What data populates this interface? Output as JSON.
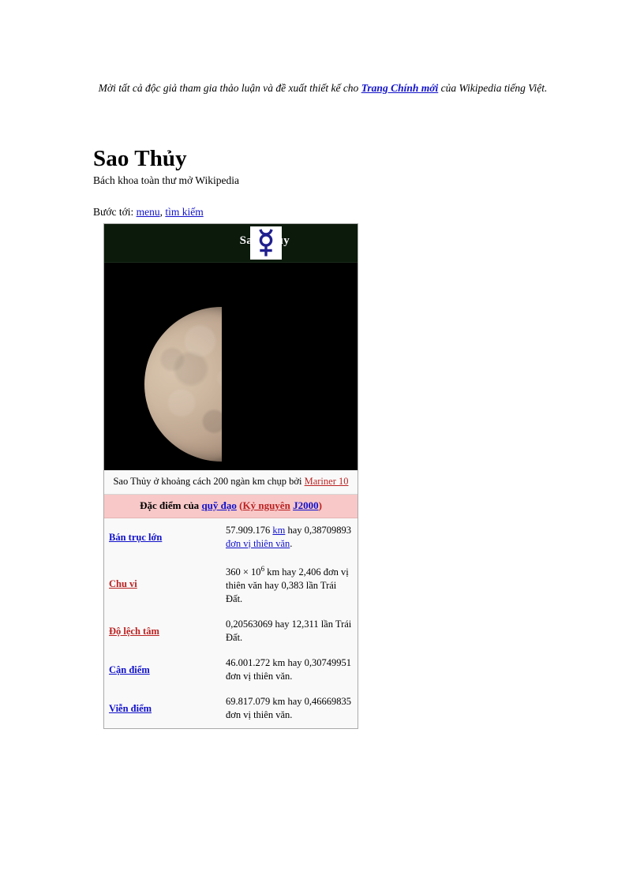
{
  "sitenotice": {
    "before": "Mời tất cả độc giả tham gia thảo luận và đề xuất thiết kế cho ",
    "link": "Trang Chính mới",
    "after": " của Wikipedia tiếng Việt."
  },
  "page_title": "Sao Thủy",
  "tagline": "Bách khoa toàn thư mở Wikipedia",
  "jumpto": {
    "prefix": "Bước tới:",
    "link_menu": "menu",
    "separator": ",",
    "link_search": "tìm kiếm"
  },
  "infobox": {
    "header_title": "Sao Thủy",
    "symbol_name": "mercury-astronomical-symbol",
    "symbol_glyph": "☿",
    "symbol_color": "#1f1f8f",
    "header_bg": "#0b1a0b",
    "caption": {
      "text": "Sao Thủy ở khoảng cách 200 ngàn km chụp bởi ",
      "link": "Mariner 10"
    },
    "section": {
      "prefix": "Đặc điểm của ",
      "link_orbit": "quỹ đạo",
      "open_paren": " (",
      "link_epoch": "Kỷ nguyên",
      "space": " ",
      "link_j2000": "J2000",
      "close_paren": ")"
    },
    "section_bg": "#f8c8c8",
    "rows": [
      {
        "label": "Bán trục lớn",
        "label_color": "blue",
        "value_parts": [
          {
            "t": "57.909.176 ",
            "link": false
          },
          {
            "t": "km",
            "link": true
          },
          {
            "t": " hay 0,38709893 ",
            "link": false
          },
          {
            "t": "đơn vị thiên văn",
            "link": true
          },
          {
            "t": ".",
            "link": false
          }
        ]
      },
      {
        "label": "Chu vi",
        "label_color": "red",
        "value_parts": [
          {
            "t": "360 × 10",
            "link": false
          },
          {
            "t": "6",
            "sup": true
          },
          {
            "t": " km hay 2,406 đơn vị thiên văn hay 0,383 lần Trái Đất.",
            "link": false
          }
        ]
      },
      {
        "label": "Độ lệch tâm",
        "label_color": "red",
        "value_parts": [
          {
            "t": "0,20563069 hay 12,311 lần Trái Đất.",
            "link": false
          }
        ]
      },
      {
        "label": "Cận điểm",
        "label_color": "blue",
        "value_parts": [
          {
            "t": "46.001.272 km hay 0,30749951 đơn vị thiên văn.",
            "link": false
          }
        ]
      },
      {
        "label": "Viễn điểm",
        "label_color": "blue",
        "value_parts": [
          {
            "t": "69.817.079 km hay 0,46669835 đơn vị thiên văn.",
            "link": false
          }
        ]
      }
    ]
  }
}
